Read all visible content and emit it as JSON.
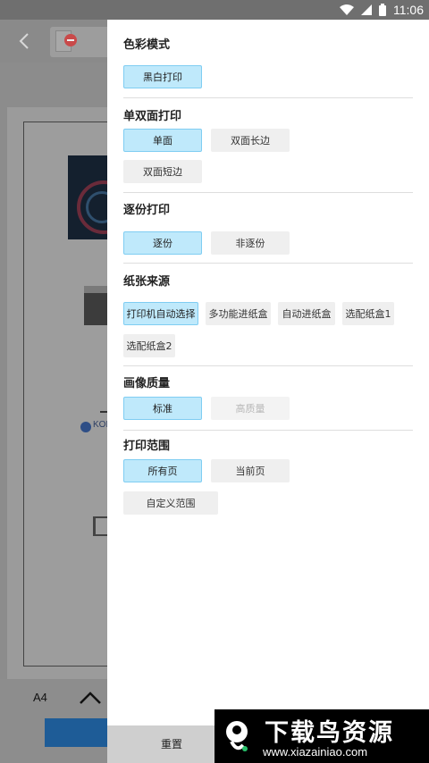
{
  "status_bar": {
    "time": "11:06",
    "icons": [
      "wifi-icon",
      "signal-icon",
      "battery-icon"
    ]
  },
  "background": {
    "paper_size": "A4",
    "logo_text": "KON",
    "glyph": "一"
  },
  "sections": {
    "color_mode": {
      "title": "色彩模式",
      "options": [
        "黑白打印"
      ],
      "selected": "黑白打印"
    },
    "duplex": {
      "title": "单双面打印",
      "options": [
        "单面",
        "双面长边",
        "双面短边"
      ],
      "selected": "单面"
    },
    "collate": {
      "title": "逐份打印",
      "options": [
        "逐份",
        "非逐份"
      ],
      "selected": "逐份"
    },
    "paper_source": {
      "title": "纸张来源",
      "options": [
        "打印机自动选择",
        "多功能进纸盒",
        "自动进纸盒",
        "选配纸盒1",
        "选配纸盒2"
      ],
      "selected": "打印机自动选择"
    },
    "quality": {
      "title": "画像质量",
      "options": [
        "标准",
        "高质量"
      ],
      "selected": "标准",
      "disabled": [
        "高质量"
      ]
    },
    "range": {
      "title": "打印范围",
      "options": [
        "所有页",
        "当前页",
        "自定义范围"
      ],
      "selected": "所有页"
    }
  },
  "footer": {
    "reset_label": "重置"
  },
  "watermark": {
    "title": "下载鸟资源",
    "url": "www.xiazainiao.com"
  },
  "colors": {
    "selected_bg": "#bfe9fb",
    "selected_border": "#7fcdf2",
    "option_bg": "#efefef",
    "accent_blue": "#1e5c97"
  }
}
